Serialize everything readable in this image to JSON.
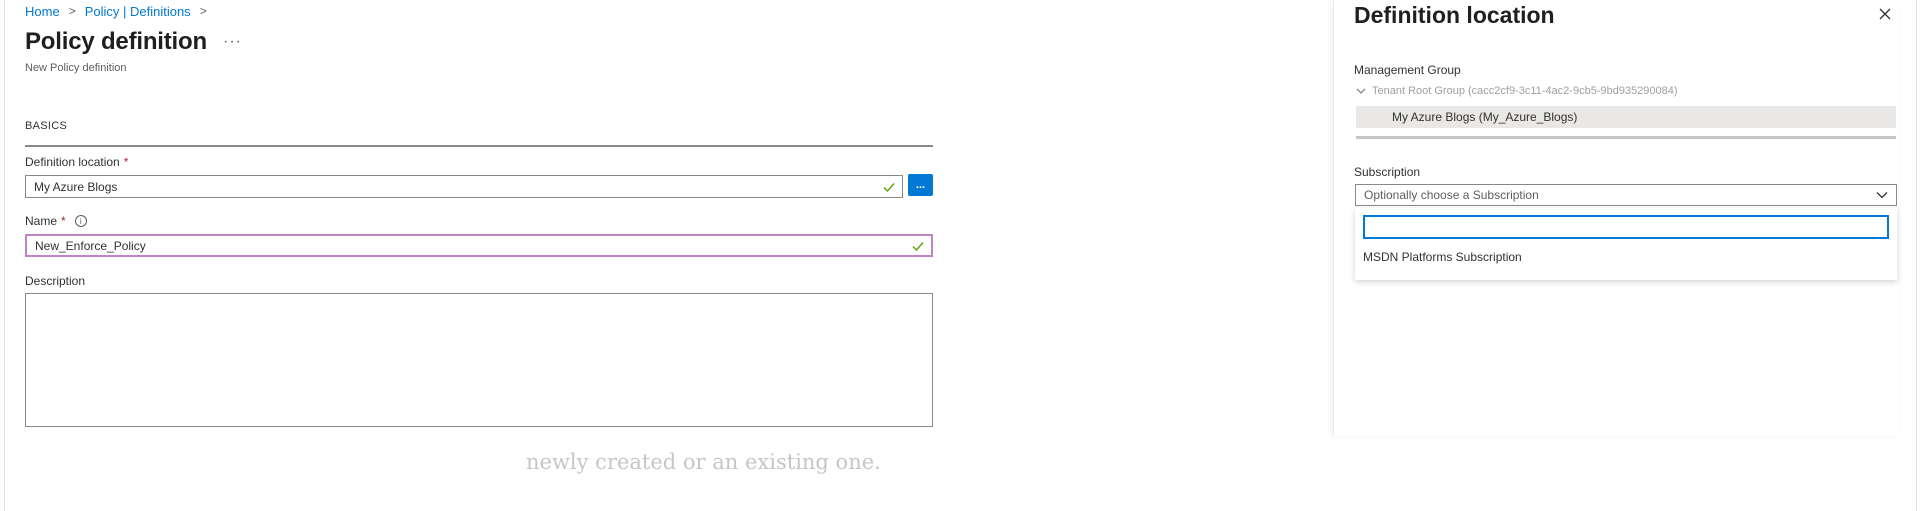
{
  "breadcrumb": [
    {
      "label": "Home"
    },
    {
      "label": "Policy | Definitions"
    }
  ],
  "breadcrumb_separator": ">",
  "page": {
    "title": "Policy definition",
    "more_label": "···",
    "subtitle": "New Policy definition"
  },
  "basics": {
    "section_label": "BASICS",
    "definition_location": {
      "label": "Definition location",
      "required_mark": "*",
      "value": "My Azure Blogs",
      "browse_label": "..."
    },
    "name": {
      "label": "Name",
      "required_mark": "*",
      "info_glyph": "i",
      "value": "New_Enforce_Policy"
    },
    "description": {
      "label": "Description",
      "value": ""
    }
  },
  "background_text": {
    "line": "newly created or an existing one."
  },
  "blade": {
    "title": "Definition location",
    "close_icon": "close-icon",
    "management_group": {
      "label": "Management Group",
      "root": "Tenant Root Group (cacc2cf9-3c11-4ac2-9cb5-9bd935290084)",
      "selected": "My Azure Blogs (My_Azure_Blogs)"
    },
    "subscription": {
      "label": "Subscription",
      "placeholder": "Optionally choose a Subscription",
      "search_value": "",
      "options": [
        "MSDN Platforms Subscription"
      ]
    }
  },
  "colors": {
    "accent": "#0078d4",
    "focus_border": "#c083c8",
    "required": "#a4262c",
    "valid_check": "#57a300"
  }
}
